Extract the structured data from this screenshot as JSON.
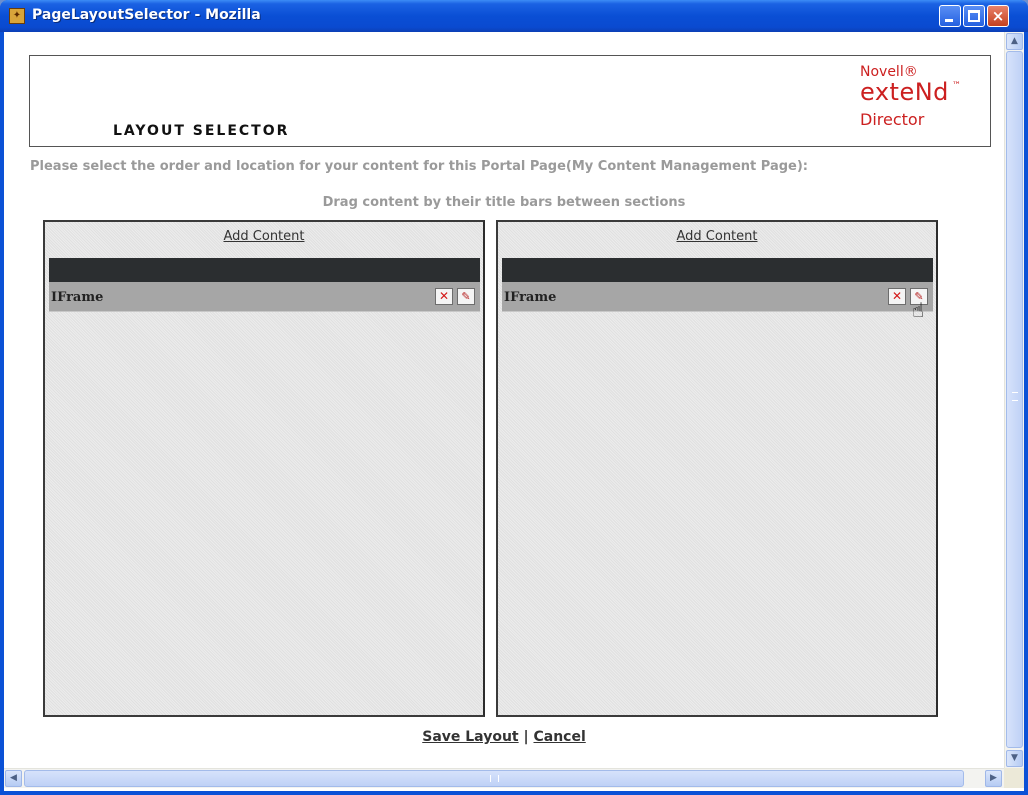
{
  "window": {
    "title": "PageLayoutSelector - Mozilla",
    "icon": "mozilla-app-icon",
    "close_glyph": "×"
  },
  "header": {
    "heading": "LAYOUT SELECTOR",
    "logo": {
      "novell": "Novell®",
      "extend": "exteNd",
      "tm": "™",
      "director": "Director",
      "color": "#cc2020"
    }
  },
  "instruction": "Please select the order and location for your content for this Portal Page(My Content Management Page):",
  "drag_hint": "Drag content by their title bars between sections",
  "sections": [
    {
      "add_content_label": "Add Content",
      "portlets": [
        {
          "title": "IFrame",
          "delete_glyph": "✕",
          "edit_glyph": "✎"
        }
      ]
    },
    {
      "add_content_label": "Add Content",
      "portlets": [
        {
          "title": "IFrame",
          "delete_glyph": "✕",
          "edit_glyph": "✎"
        }
      ]
    }
  ],
  "footer": {
    "save_label": "Save Layout",
    "separator": "|",
    "cancel_label": "Cancel"
  },
  "scrollbars": {
    "up_arrow": "▲",
    "down_arrow": "▼",
    "left_arrow": "◀",
    "right_arrow": "▶"
  },
  "cursor": "hand-pointer-icon"
}
